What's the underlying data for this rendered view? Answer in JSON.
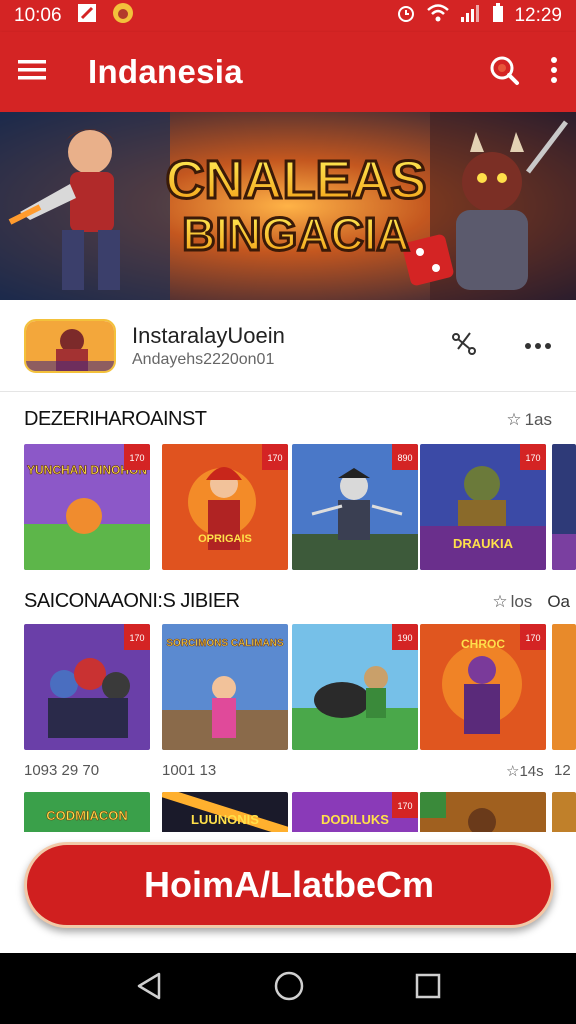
{
  "status_bar": {
    "time_left": "10:06",
    "time_right": "12:29"
  },
  "app_bar": {
    "title": "Indanesia",
    "menu_icon": "hamburger-menu-icon",
    "search_icon": "search-icon",
    "more_icon": "more-vert-icon"
  },
  "banner": {
    "line1": "CNALEAS",
    "line2": "BINGACIA"
  },
  "featured": {
    "title": "InstaralayUoein",
    "subtitle": "Andayehs2220on01"
  },
  "section1": {
    "title": "DEZERIHAROAINST",
    "meta": "1as"
  },
  "section2": {
    "title": "SAICONAAONI:S JIBIER",
    "meta": "los",
    "overflow_label": "Oa"
  },
  "section2_captions": {
    "c1": "1093 29 70",
    "c2": "1001 13",
    "c3": "14s",
    "c4": "12"
  },
  "row1_tiles": [
    {
      "name": "tile-yunchan",
      "text": "YUNCHAN DINOHON",
      "badge": "170"
    },
    {
      "name": "tile-oprigais",
      "text": "OPRIGAIS",
      "badge": "170"
    },
    {
      "name": "tile-ninja",
      "text": "",
      "badge": "890"
    },
    {
      "name": "tile-draukia",
      "text": "DRAUKIA",
      "badge": "170"
    }
  ],
  "row2_tiles": [
    {
      "name": "tile-heroes",
      "text": "",
      "badge": "170"
    },
    {
      "name": "tile-sorcimons",
      "text": "SORCIMONS CALIMANS",
      "badge": ""
    },
    {
      "name": "tile-panther",
      "text": "",
      "badge": "190"
    },
    {
      "name": "tile-chroc",
      "text": "CHROC",
      "badge": "170"
    }
  ],
  "row3_tiles": [
    {
      "name": "tile-codmiacon",
      "text": "CODMIACON"
    },
    {
      "name": "tile-luunonis",
      "text": "LUUNONIS"
    },
    {
      "name": "tile-dodiluks",
      "text": "DODILUKS",
      "badge": "170"
    },
    {
      "name": "tile-warrior",
      "text": ""
    }
  ],
  "cta": {
    "label": "HoimA/LlatbeCm"
  },
  "colors": {
    "primary_red": "#d42424",
    "cta_red": "#d01f1f",
    "nav_black": "#000000"
  }
}
